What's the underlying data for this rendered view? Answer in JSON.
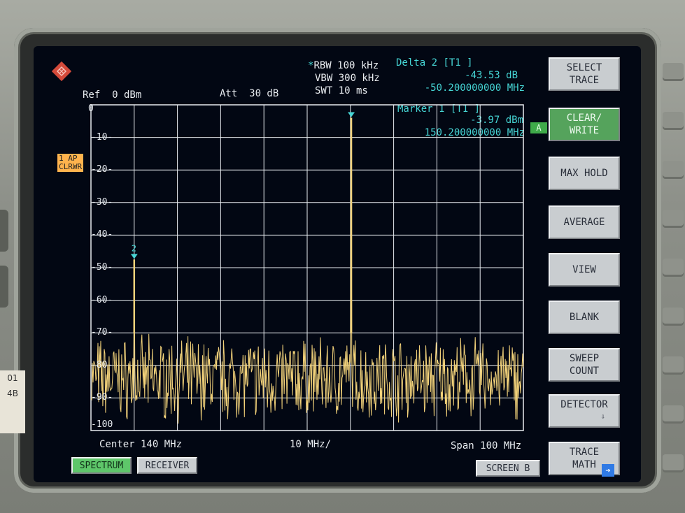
{
  "header": {
    "rbw_marker": "*",
    "rbw": "RBW 100 kHz",
    "vbw": "VBW 300 kHz",
    "swt": "SWT 10 ms",
    "ref": "Ref  0 dBm",
    "att": "Att  30 dB"
  },
  "markers": {
    "delta_title": "Delta 2 [T1 ]",
    "delta_level": "-43.53 dB",
    "delta_freq": "-50.200000000 MHz",
    "marker1_title": "Marker 1 [T1 ]",
    "marker1_level": "-3.97 dBm",
    "marker1_freq": "150.200000000 MHz",
    "delta_label": "2"
  },
  "trace_badge": {
    "line1": "1 AP",
    "line2": "CLRWR"
  },
  "a_badge": "A",
  "footer": {
    "center": "Center 140 MHz",
    "div": "10 MHz/",
    "span": "Span 100 MHz"
  },
  "tabs": {
    "spectrum": "SPECTRUM",
    "receiver": "RECEIVER",
    "screen_b": "SCREEN B"
  },
  "softkeys": [
    {
      "line1": "SELECT",
      "line2": "TRACE"
    },
    {
      "line1": "CLEAR/",
      "line2": "WRITE"
    },
    {
      "line1": "MAX HOLD",
      "line2": ""
    },
    {
      "line1": "AVERAGE",
      "line2": ""
    },
    {
      "line1": "VIEW",
      "line2": ""
    },
    {
      "line1": "BLANK",
      "line2": ""
    },
    {
      "line1": "SWEEP",
      "line2": "COUNT"
    },
    {
      "line1": "DETECTOR",
      "line2": ""
    },
    {
      "line1": "TRACE",
      "line2": "MATH"
    }
  ],
  "sticker": {
    "line1": "01",
    "line2": "4B"
  },
  "colors": {
    "trace": "#f2d27a",
    "accent": "#46d6d6",
    "active_key": "#55a35c"
  },
  "chart_data": {
    "type": "line",
    "xlabel": "",
    "ylabel": "",
    "xlim": [
      90,
      190
    ],
    "ylim": [
      -100,
      0
    ],
    "y_ticks": [
      "0",
      "-10",
      "-20",
      "-30",
      "-40",
      "-50",
      "-60",
      "-70",
      "-80",
      "-90",
      "-100"
    ],
    "noise_floor_range": [
      -98,
      -70
    ],
    "peaks": [
      {
        "name": "Marker 1",
        "freq_mhz": 150.2,
        "level_dbm": -3.97
      },
      {
        "name": "Delta 2",
        "freq_mhz": 100.0,
        "level_dbm": -47.5
      }
    ],
    "grid": true
  }
}
